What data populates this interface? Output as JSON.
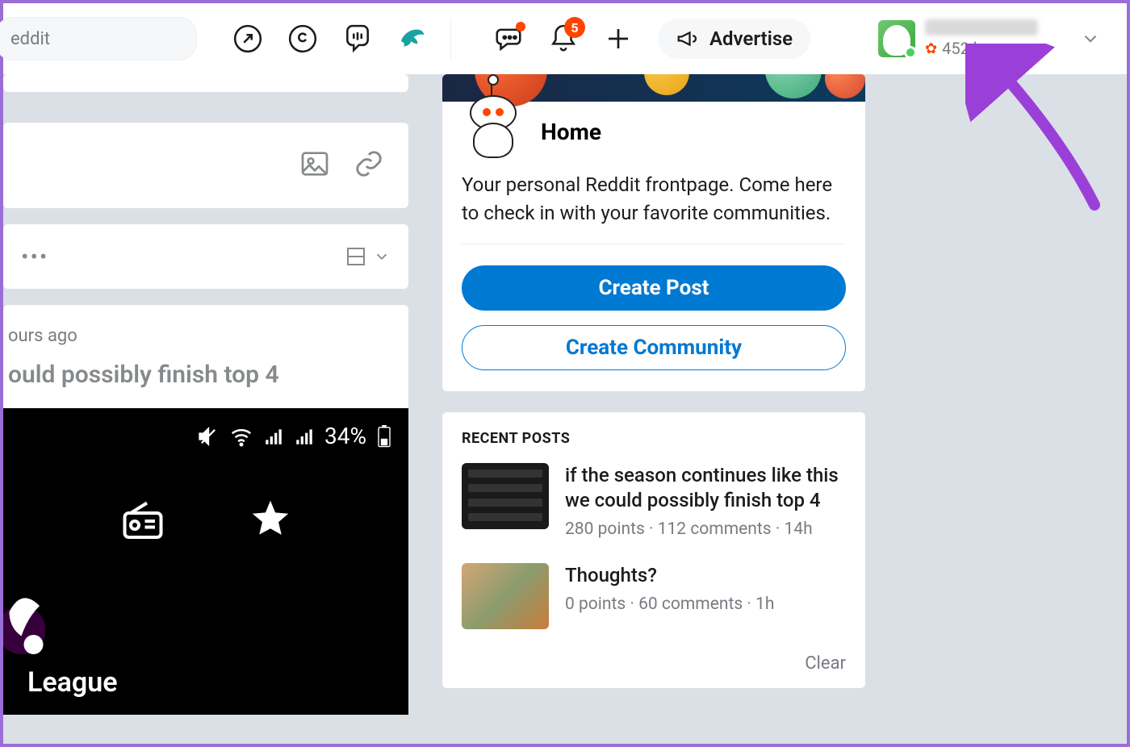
{
  "header": {
    "search_placeholder": "eddit",
    "notif_count": "5",
    "advertise_label": "Advertise",
    "karma_text": "452 karma"
  },
  "compose": {},
  "feed": {
    "post_time": "ours ago",
    "post_title": "ould possibly finish top 4",
    "battery": "34%",
    "league_text": "League"
  },
  "home_card": {
    "title": "Home",
    "description": "Your personal Reddit frontpage. Come here to check in with your favorite communities.",
    "create_post": "Create Post",
    "create_community": "Create Community"
  },
  "recent": {
    "heading": "RECENT POSTS",
    "items": [
      {
        "title": "if the season continues like this we could possibly finish top 4",
        "meta": "280 points · 112 comments · 14h"
      },
      {
        "title": "Thoughts?",
        "meta": "0 points · 60 comments · 1h"
      }
    ],
    "clear": "Clear"
  }
}
